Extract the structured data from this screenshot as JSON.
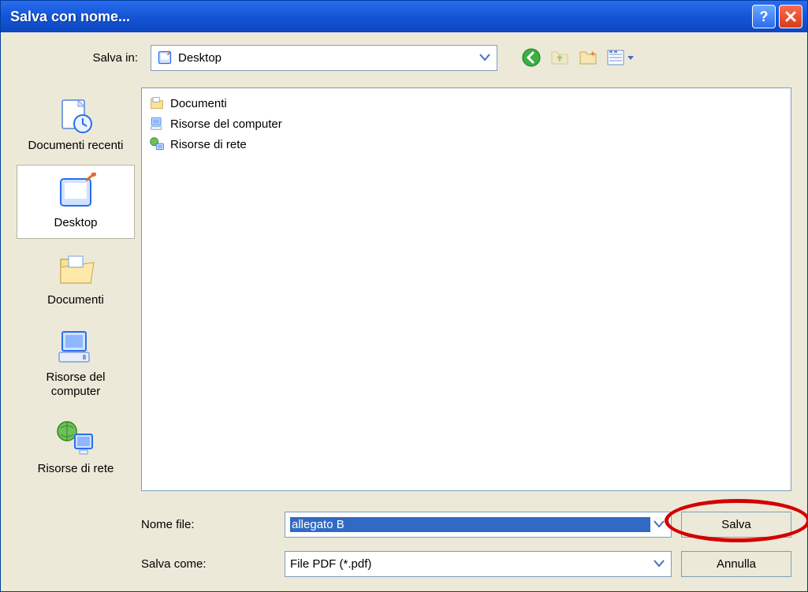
{
  "window": {
    "title": "Salva con nome..."
  },
  "top": {
    "salva_in_label": "Salva in:",
    "location": "Desktop"
  },
  "places": {
    "items": [
      {
        "label": "Documenti recenti"
      },
      {
        "label": "Desktop"
      },
      {
        "label": "Documenti"
      },
      {
        "label": "Risorse del computer"
      },
      {
        "label": "Risorse di rete"
      }
    ],
    "selected_index": 1
  },
  "file_list": [
    {
      "icon": "folder",
      "label": "Documenti"
    },
    {
      "icon": "computer",
      "label": "Risorse del computer"
    },
    {
      "icon": "network",
      "label": "Risorse di rete"
    }
  ],
  "bottom": {
    "filename_label": "Nome file:",
    "filename_value": "allegato B",
    "savetype_label": "Salva come:",
    "savetype_value": "File PDF (*.pdf)",
    "save_button": "Salva",
    "cancel_button": "Annulla"
  }
}
